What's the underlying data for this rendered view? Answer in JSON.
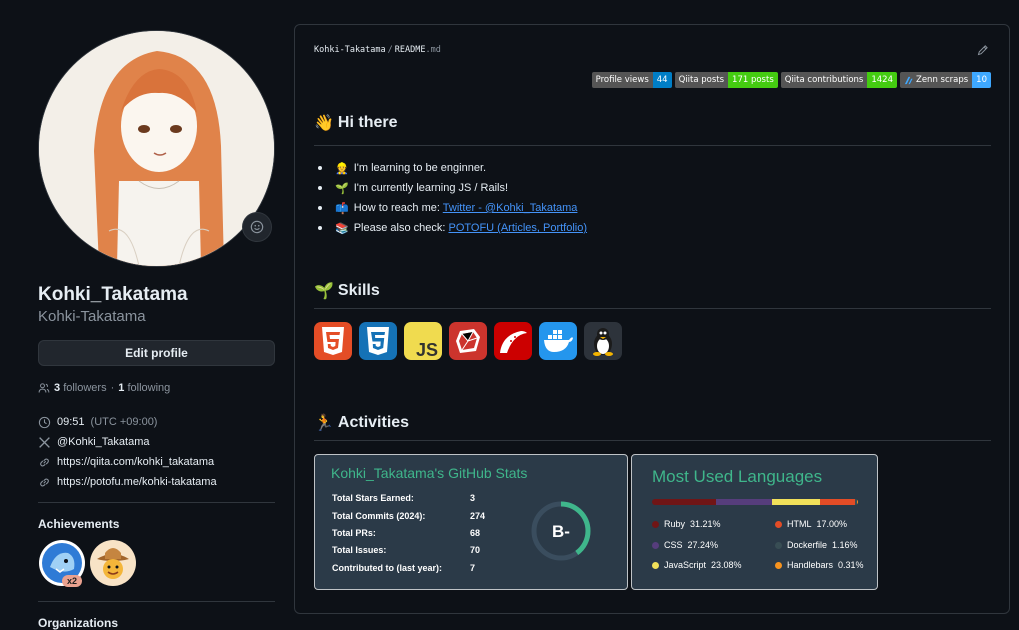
{
  "profile": {
    "name": "Kohki_Takatama",
    "login": "Kohki-Takatama",
    "edit_label": "Edit profile",
    "followers_count": "3",
    "followers_label": "followers",
    "dot": "·",
    "following_count": "1",
    "following_label": "following",
    "time": "09:51",
    "timezone": "(UTC +09:00)",
    "twitter": "@Kohki_Takatama",
    "link1": "https://qiita.com/kohki_takatama",
    "link2": "https://potofu.me/kohki-takatama",
    "achievements_title": "Achievements",
    "achievement_count": "x2",
    "organizations_title": "Organizations"
  },
  "readme": {
    "repo": "Kohki-Takatama",
    "sep": "/",
    "file": "README",
    "ext": ".md",
    "badges": [
      {
        "label": "Profile views",
        "value": "44",
        "color": "#007ec6"
      },
      {
        "label": "Qiita posts",
        "value": "171 posts",
        "color": "#4c1"
      },
      {
        "label": "Qiita contributions",
        "value": "1424",
        "color": "#4c1"
      },
      {
        "label": "Zenn scraps",
        "value": "10",
        "color": "#3ea8ff"
      }
    ],
    "hi_title": "Hi there",
    "hi_emoji": "👋",
    "list": [
      {
        "emoji": "👷",
        "text": "I'm learning to be enginner.",
        "link": ""
      },
      {
        "emoji": "🌱",
        "text": "I'm currently learning JS / Rails!",
        "link": ""
      },
      {
        "emoji": "📫",
        "text": "How to reach me: ",
        "link": "Twitter - @Kohki_Takatama"
      },
      {
        "emoji": "📚",
        "text": "Please also check: ",
        "link": "POTOFU (Articles, Portfolio)"
      }
    ],
    "skills_title": "Skills",
    "skills_emoji": "🌱",
    "skills": [
      "html5-icon",
      "css3-icon",
      "javascript-icon",
      "ruby-icon",
      "rails-icon",
      "docker-icon",
      "linux-icon"
    ],
    "activities_title": "Activities",
    "activities_emoji": "🏃"
  },
  "stats": {
    "title": "Kohki_Takatama's GitHub Stats",
    "rows": [
      {
        "label": "Total Stars Earned:",
        "value": "3"
      },
      {
        "label": "Total Commits (2024):",
        "value": "274"
      },
      {
        "label": "Total PRs:",
        "value": "68"
      },
      {
        "label": "Total Issues:",
        "value": "70"
      },
      {
        "label": "Contributed to (last year):",
        "value": "7"
      }
    ],
    "grade": "B-",
    "grade_progress": 0.4
  },
  "languages": {
    "title": "Most Used Languages",
    "items": [
      {
        "name": "Ruby",
        "percent": "31.21%",
        "value": 31.21,
        "color": "#701516"
      },
      {
        "name": "CSS",
        "percent": "27.24%",
        "value": 27.24,
        "color": "#563d7c"
      },
      {
        "name": "HTML",
        "percent": "17.00%",
        "value": 17.0,
        "color": "#e34c26"
      },
      {
        "name": "JavaScript",
        "percent": "23.08%",
        "value": 23.08,
        "color": "#f1e05a"
      },
      {
        "name": "Dockerfile",
        "percent": "1.16%",
        "value": 1.16,
        "color": "#384d54"
      },
      {
        "name": "Handlebars",
        "percent": "0.31%",
        "value": 0.31,
        "color": "#f7931e"
      }
    ]
  }
}
